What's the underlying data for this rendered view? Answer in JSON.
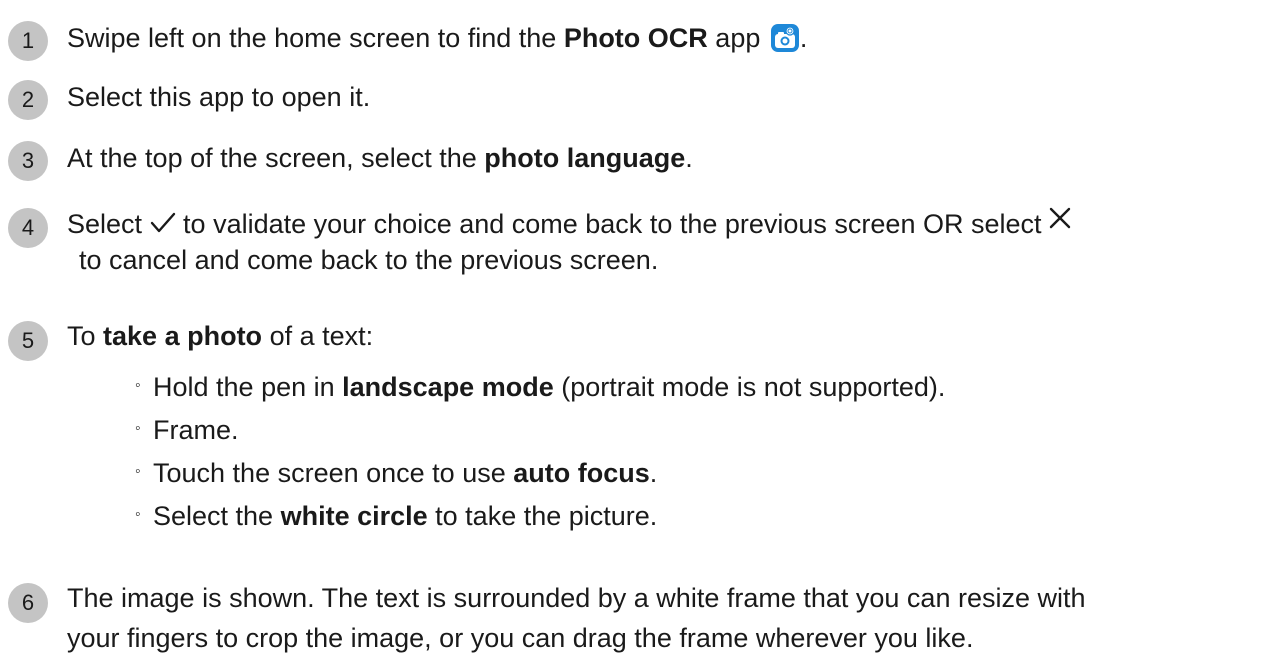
{
  "steps": [
    {
      "number": "1",
      "parts": [
        "Swipe left on the home screen to find the ",
        "Photo OCR",
        " app ",
        "."
      ],
      "icon": "photo-ocr-app-icon"
    },
    {
      "number": "2",
      "text": "Select this app to open it."
    },
    {
      "number": "3",
      "parts": [
        "At the top of the screen, select the ",
        "photo language",
        "."
      ]
    },
    {
      "number": "4",
      "parts": [
        "Select ",
        " to validate your choice and come back to the previous screen OR select ",
        "to cancel and come back to the previous screen."
      ],
      "icons": [
        "checkmark-icon",
        "close-icon"
      ]
    },
    {
      "number": "5",
      "parts": [
        "To ",
        "take a photo",
        " of a text:"
      ],
      "bullet": "◦",
      "subitems": [
        {
          "parts": [
            "Hold the pen in ",
            "landscape mode",
            " (portrait mode is not supported)."
          ]
        },
        {
          "text": "Frame."
        },
        {
          "parts": [
            "Touch the screen once to use ",
            "auto focus",
            "."
          ]
        },
        {
          "parts": [
            "Select the ",
            "white circle",
            " to take the picture."
          ]
        }
      ]
    },
    {
      "number": "6",
      "lines": [
        "The image is shown. The text is surrounded by a white frame that you can resize with",
        "your fingers to crop the image, or you can drag the frame wherever you like."
      ]
    }
  ],
  "colors": {
    "badge": "#c4c4c4",
    "text": "#1a1a1a",
    "app_icon": "#1e88d8"
  }
}
